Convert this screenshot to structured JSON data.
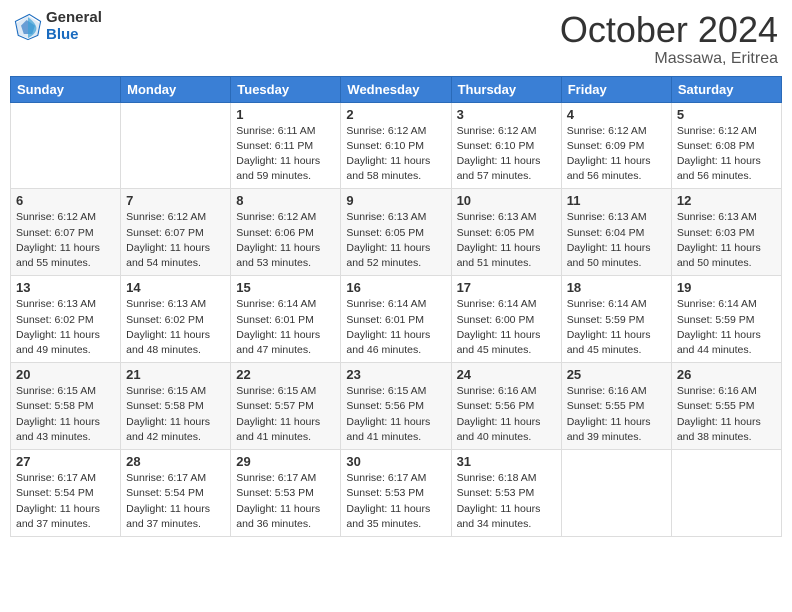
{
  "header": {
    "logo_general": "General",
    "logo_blue": "Blue",
    "month": "October 2024",
    "location": "Massawa, Eritrea"
  },
  "weekdays": [
    "Sunday",
    "Monday",
    "Tuesday",
    "Wednesday",
    "Thursday",
    "Friday",
    "Saturday"
  ],
  "weeks": [
    [
      null,
      null,
      {
        "day": "1",
        "sunrise": "6:11 AM",
        "sunset": "6:11 PM",
        "daylight": "11 hours and 59 minutes."
      },
      {
        "day": "2",
        "sunrise": "6:12 AM",
        "sunset": "6:10 PM",
        "daylight": "11 hours and 58 minutes."
      },
      {
        "day": "3",
        "sunrise": "6:12 AM",
        "sunset": "6:10 PM",
        "daylight": "11 hours and 57 minutes."
      },
      {
        "day": "4",
        "sunrise": "6:12 AM",
        "sunset": "6:09 PM",
        "daylight": "11 hours and 56 minutes."
      },
      {
        "day": "5",
        "sunrise": "6:12 AM",
        "sunset": "6:08 PM",
        "daylight": "11 hours and 56 minutes."
      }
    ],
    [
      {
        "day": "6",
        "sunrise": "6:12 AM",
        "sunset": "6:07 PM",
        "daylight": "11 hours and 55 minutes."
      },
      {
        "day": "7",
        "sunrise": "6:12 AM",
        "sunset": "6:07 PM",
        "daylight": "11 hours and 54 minutes."
      },
      {
        "day": "8",
        "sunrise": "6:12 AM",
        "sunset": "6:06 PM",
        "daylight": "11 hours and 53 minutes."
      },
      {
        "day": "9",
        "sunrise": "6:13 AM",
        "sunset": "6:05 PM",
        "daylight": "11 hours and 52 minutes."
      },
      {
        "day": "10",
        "sunrise": "6:13 AM",
        "sunset": "6:05 PM",
        "daylight": "11 hours and 51 minutes."
      },
      {
        "day": "11",
        "sunrise": "6:13 AM",
        "sunset": "6:04 PM",
        "daylight": "11 hours and 50 minutes."
      },
      {
        "day": "12",
        "sunrise": "6:13 AM",
        "sunset": "6:03 PM",
        "daylight": "11 hours and 50 minutes."
      }
    ],
    [
      {
        "day": "13",
        "sunrise": "6:13 AM",
        "sunset": "6:02 PM",
        "daylight": "11 hours and 49 minutes."
      },
      {
        "day": "14",
        "sunrise": "6:13 AM",
        "sunset": "6:02 PM",
        "daylight": "11 hours and 48 minutes."
      },
      {
        "day": "15",
        "sunrise": "6:14 AM",
        "sunset": "6:01 PM",
        "daylight": "11 hours and 47 minutes."
      },
      {
        "day": "16",
        "sunrise": "6:14 AM",
        "sunset": "6:01 PM",
        "daylight": "11 hours and 46 minutes."
      },
      {
        "day": "17",
        "sunrise": "6:14 AM",
        "sunset": "6:00 PM",
        "daylight": "11 hours and 45 minutes."
      },
      {
        "day": "18",
        "sunrise": "6:14 AM",
        "sunset": "5:59 PM",
        "daylight": "11 hours and 45 minutes."
      },
      {
        "day": "19",
        "sunrise": "6:14 AM",
        "sunset": "5:59 PM",
        "daylight": "11 hours and 44 minutes."
      }
    ],
    [
      {
        "day": "20",
        "sunrise": "6:15 AM",
        "sunset": "5:58 PM",
        "daylight": "11 hours and 43 minutes."
      },
      {
        "day": "21",
        "sunrise": "6:15 AM",
        "sunset": "5:58 PM",
        "daylight": "11 hours and 42 minutes."
      },
      {
        "day": "22",
        "sunrise": "6:15 AM",
        "sunset": "5:57 PM",
        "daylight": "11 hours and 41 minutes."
      },
      {
        "day": "23",
        "sunrise": "6:15 AM",
        "sunset": "5:56 PM",
        "daylight": "11 hours and 41 minutes."
      },
      {
        "day": "24",
        "sunrise": "6:16 AM",
        "sunset": "5:56 PM",
        "daylight": "11 hours and 40 minutes."
      },
      {
        "day": "25",
        "sunrise": "6:16 AM",
        "sunset": "5:55 PM",
        "daylight": "11 hours and 39 minutes."
      },
      {
        "day": "26",
        "sunrise": "6:16 AM",
        "sunset": "5:55 PM",
        "daylight": "11 hours and 38 minutes."
      }
    ],
    [
      {
        "day": "27",
        "sunrise": "6:17 AM",
        "sunset": "5:54 PM",
        "daylight": "11 hours and 37 minutes."
      },
      {
        "day": "28",
        "sunrise": "6:17 AM",
        "sunset": "5:54 PM",
        "daylight": "11 hours and 37 minutes."
      },
      {
        "day": "29",
        "sunrise": "6:17 AM",
        "sunset": "5:53 PM",
        "daylight": "11 hours and 36 minutes."
      },
      {
        "day": "30",
        "sunrise": "6:17 AM",
        "sunset": "5:53 PM",
        "daylight": "11 hours and 35 minutes."
      },
      {
        "day": "31",
        "sunrise": "6:18 AM",
        "sunset": "5:53 PM",
        "daylight": "11 hours and 34 minutes."
      },
      null,
      null
    ]
  ],
  "labels": {
    "sunrise": "Sunrise: ",
    "sunset": "Sunset: ",
    "daylight": "Daylight: "
  }
}
